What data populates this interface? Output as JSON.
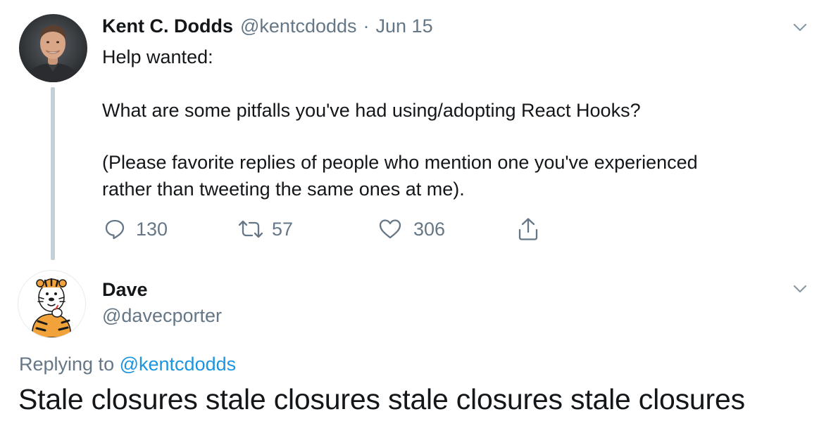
{
  "tweet": {
    "author_name": "Kent C. Dodds",
    "author_handle": "@kentcdodds",
    "separator": "·",
    "date": "Jun 15",
    "text_lines": [
      "Help wanted:",
      "What are some pitfalls you've had using/adopting React Hooks?",
      "(Please favorite replies of people who mention one you've experienced",
      "rather than tweeting the same ones at me)."
    ],
    "actions": {
      "reply_icon": "reply-icon",
      "reply_count": "130",
      "retweet_icon": "retweet-icon",
      "retweet_count": "57",
      "like_icon": "heart-icon",
      "like_count": "306",
      "share_icon": "share-icon"
    }
  },
  "reply": {
    "author_name": "Dave",
    "author_handle": "@davecporter",
    "replying_to_label": "Replying to",
    "replying_to_handle": "@kentcdodds",
    "text": "Stale closures stale closures stale closures stale closures"
  },
  "colors": {
    "text_primary": "#14171a",
    "text_secondary": "#657786",
    "link": "#1b95e0",
    "thread_line": "#c4cfd6"
  }
}
